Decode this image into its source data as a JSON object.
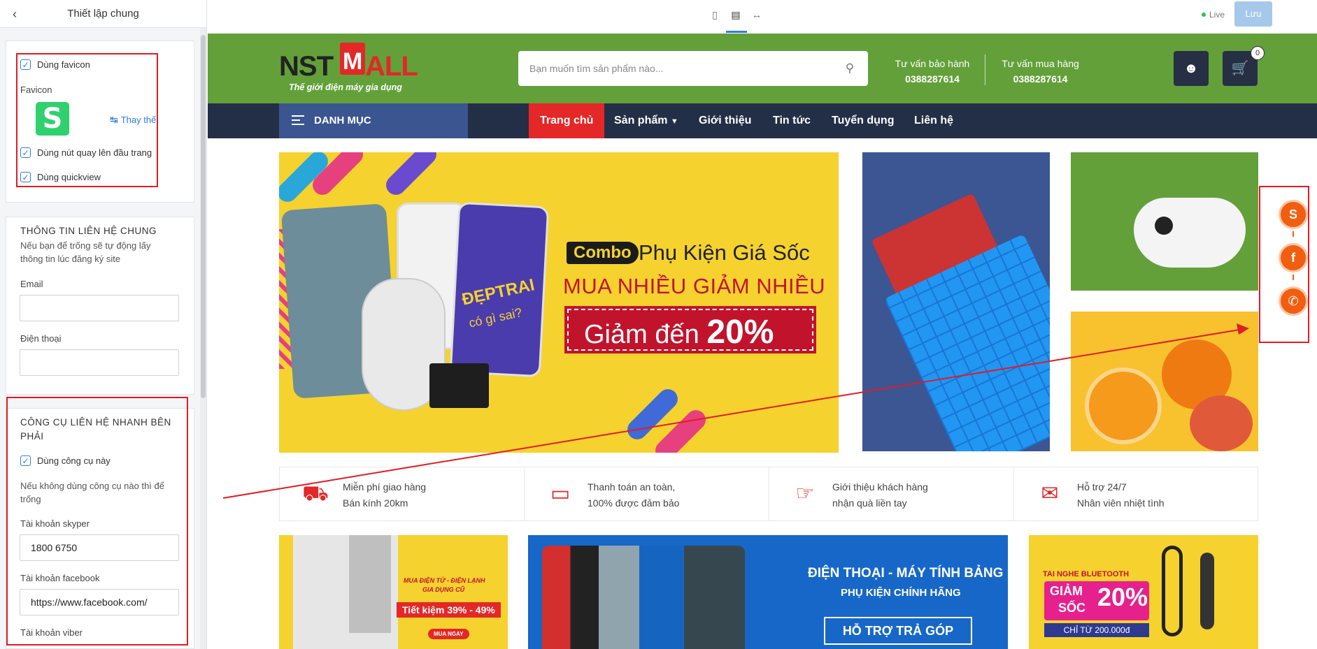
{
  "panel": {
    "title": "Thiết lập chung",
    "use_favicon": "Dùng favicon",
    "favicon_label": "Favicon",
    "favicon_letter": "S",
    "replace_label": "Thay thế",
    "back_to_top": "Dùng nút quay lên đầu trang",
    "quickview": "Dùng quickview",
    "contact_section": {
      "title": "THÔNG TIN LIÊN HỆ CHUNG",
      "help_line1": "Nếu bạn để trống sẽ tự động lấy",
      "help_line2": "thông tin lúc đăng ký site",
      "email_label": "Email",
      "email_value": "",
      "phone_label": "Điện thoại",
      "phone_value": ""
    },
    "quick_contact": {
      "title_line1": "CÔNG CỤ LIÊN HỆ NHANH BÊN",
      "title_line2": "PHẢI",
      "use_tool": "Dùng công cụ này",
      "help_line1": "Nếu không dùng công cụ nào thì để",
      "help_line2": "trống",
      "skype_label": "Tài khoản skyper",
      "skype_value": "1800 6750",
      "facebook_label": "Tài khoản facebook",
      "facebook_value": "https://www.facebook.com/",
      "viber_label": "Tài khoản viber"
    }
  },
  "topbar": {
    "live": "Live",
    "save": "Lưu",
    "devices": [
      "mobile-icon",
      "desktop-icon",
      "fullwidth-icon"
    ]
  },
  "site": {
    "logo_nst": "NST",
    "logo_m": "M",
    "logo_all": "ALL",
    "tagline": "Thế giới điện máy gia dụng",
    "search_placeholder": "Bạn muốn tìm sản phẩm nào...",
    "hotline1_label": "Tư vấn bảo hành",
    "hotline1_number": "0388287614",
    "hotline2_label": "Tư vấn mua hàng",
    "hotline2_number": "0388287614",
    "cart_count": "0",
    "category_label": "DANH MỤC",
    "nav": [
      "Trang chủ",
      "Sản phẩm",
      "Giới thiệu",
      "Tin tức",
      "Tuyển dụng",
      "Liên hệ"
    ],
    "banner": {
      "combo": "Combo",
      "line1": "Phụ Kiện Giá Sốc",
      "line2": "MUA NHIỀU GIẢM NHIỀU",
      "line3a": "Giảm đến ",
      "line3b": "20%",
      "phone_text1": "ĐẸPTRAI",
      "phone_text2": "có gì sai?"
    },
    "features": [
      {
        "icon": "truck-icon",
        "line1": "Miễn phí giao hàng",
        "line2": "Bán kính 20km"
      },
      {
        "icon": "card-icon",
        "line1": "Thanh toán an toàn,",
        "line2": "100% được đảm bảo"
      },
      {
        "icon": "gift-hand-icon",
        "line1": "Giới thiệu khách hàng",
        "line2": "nhận quà liền tay"
      },
      {
        "icon": "chat-icon",
        "line1": "Hỗ trợ 24/7",
        "line2": "Nhân viên nhiệt tình"
      }
    ],
    "bottom_banners": {
      "b1_line1": "MUA ĐIỆN TỬ - ĐIỆN LẠNH",
      "b1_line2": "GIA DỤNG CŨ",
      "b1_line3": "Tiết kiệm 39% - 49%",
      "b1_btn": "MUA NGAY",
      "b2_line1": "ĐIỆN THOẠI - MÁY TÍNH BẢNG",
      "b2_line2": "PHỤ KIỆN CHÍNH HÃNG",
      "b2_btn": "HỖ TRỢ TRẢ GÓP",
      "b3_line1": "TAI NGHE BLUETOOTH",
      "b3_line2": "GIẢM",
      "b3_line3": "SỐC",
      "b3_pct": "20%",
      "b3_line4": "CHỈ TỪ 200.000đ"
    },
    "float_contact": [
      "skype-icon",
      "facebook-icon",
      "viber-icon"
    ]
  },
  "colors": {
    "header_green": "#63a03a",
    "nav_dark": "#232f46",
    "accent_red": "#e42727",
    "float_orange": "#f25e10",
    "link_blue": "#2b7de9"
  }
}
